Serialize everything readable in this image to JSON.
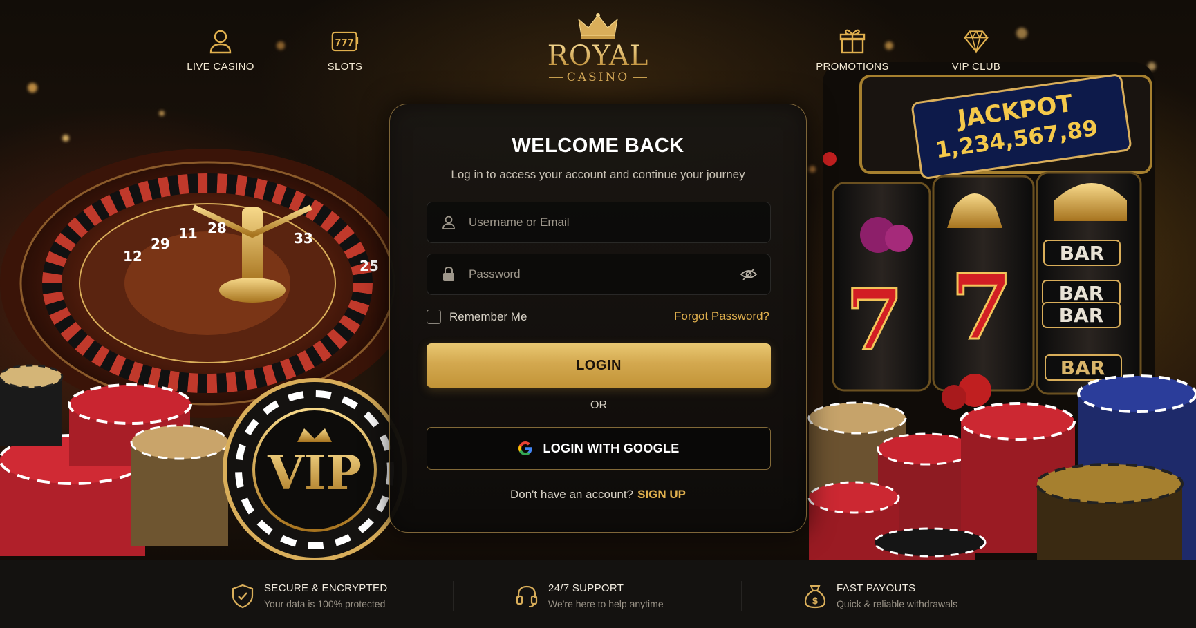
{
  "nav": {
    "items": [
      {
        "label": "LIVE CASINO",
        "icon": "user-icon"
      },
      {
        "label": "SLOTS",
        "icon": "slot-777-icon"
      },
      {
        "label": "PROMOTIONS",
        "icon": "gift-icon"
      },
      {
        "label": "VIP CLUB",
        "icon": "diamond-icon"
      }
    ]
  },
  "brand": {
    "name": "ROYAL",
    "sub": "CASINO",
    "icon": "crown-icon"
  },
  "background": {
    "jackpot_label": "JACKPOT",
    "jackpot_value": "1,234,567,89",
    "roulette_numbers": [
      "28",
      "11",
      "29",
      "12",
      "33",
      "25"
    ],
    "chip_text": "VIP",
    "reel_symbols": [
      "7",
      "BAR",
      "BAR",
      "BAR",
      "BAR"
    ]
  },
  "login": {
    "title": "WELCOME BACK",
    "subtitle": "Log in to access your account and continue your journey",
    "username_placeholder": "Username or Email",
    "password_placeholder": "Password",
    "remember_label": "Remember Me",
    "forgot_label": "Forgot Password?",
    "login_button": "LOGIN",
    "or_label": "OR",
    "google_button": "LOGIN WITH GOOGLE",
    "signup_prompt": "Don't have an account?",
    "signup_link": "SIGN UP"
  },
  "footer": {
    "features": [
      {
        "title": "SECURE & ENCRYPTED",
        "desc": "Your data is 100% protected",
        "icon": "shield-check-icon"
      },
      {
        "title": "24/7 SUPPORT",
        "desc": "We're here to help anytime",
        "icon": "headset-icon"
      },
      {
        "title": "FAST PAYOUTS",
        "desc": "Quick & reliable withdrawals",
        "icon": "money-bag-icon"
      }
    ]
  },
  "colors": {
    "accent_gold": "#e0b04e",
    "button_gold": "#d3a84f",
    "background": "#0b0906",
    "footer": "#141210"
  }
}
